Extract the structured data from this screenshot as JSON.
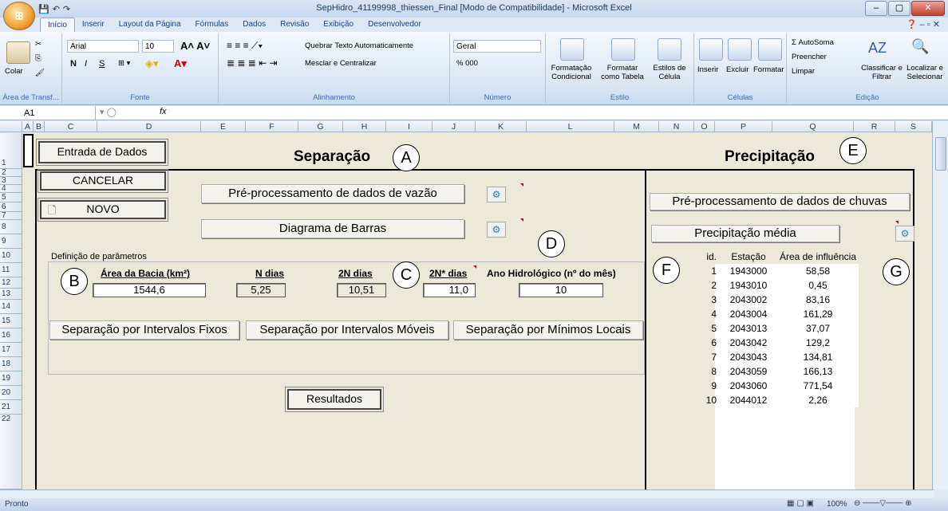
{
  "window": {
    "title": "SepHidro_41199998_thiessen_Final  [Modo de Compatibilidade] - Microsoft Excel",
    "min": "–",
    "max": "▢",
    "close": "✕"
  },
  "ribbon_tabs": [
    "Início",
    "Inserir",
    "Layout da Página",
    "Fórmulas",
    "Dados",
    "Revisão",
    "Exibição",
    "Desenvolvedor"
  ],
  "ribbon": {
    "clipboard": {
      "paste": "Colar",
      "label": "Área de Transf..."
    },
    "font": {
      "name": "Arial",
      "size": "10",
      "label": "Fonte",
      "bold": "N",
      "italic": "I",
      "underline": "S"
    },
    "alignment": {
      "wrap": "Quebrar Texto Automaticamente",
      "merge": "Mesclar e Centralizar",
      "label": "Alinhamento"
    },
    "number": {
      "format": "Geral",
      "percent": "% 000",
      "label": "Número"
    },
    "styles": {
      "cond": "Formatação Condicional",
      "table": "Formatar como Tabela",
      "cell": "Estilos de Célula",
      "label": "Estilo"
    },
    "cells": {
      "insert": "Inserir",
      "delete": "Excluir",
      "format": "Formatar",
      "label": "Células"
    },
    "editing": {
      "autosum": "Σ AutoSoma",
      "fill": "Preencher",
      "clear": "Limpar",
      "sort": "Classificar e Filtrar",
      "find": "Localizar e Selecionar",
      "label": "Edição"
    }
  },
  "formula_bar": {
    "namebox": "A1",
    "fx": "fx",
    "value": ""
  },
  "columns": [
    "A",
    "B",
    "C",
    "D",
    "E",
    "F",
    "G",
    "H",
    "I",
    "J",
    "K",
    "L",
    "M",
    "N",
    "O",
    "P",
    "Q",
    "R",
    "S"
  ],
  "rows": [
    "1",
    "2",
    "3",
    "4",
    "5",
    "6",
    "7",
    "8",
    "9",
    "10",
    "11",
    "12",
    "13",
    "14",
    "15",
    "16",
    "17",
    "18",
    "19",
    "20",
    "21",
    "22"
  ],
  "sheet": {
    "btn_entrada": "Entrada de Dados",
    "btn_cancelar": "CANCELAR",
    "btn_novo": "NOVO",
    "heading_sep": "Separação",
    "heading_prec": "Precipitação",
    "btn_preproc_vazao": "Pré-processamento de dados de vazão",
    "btn_diagrama": "Diagrama de Barras",
    "param_title": "Definição de parâmetros",
    "lbl_area": "Área da Bacia (km²)",
    "lbl_ndias": "N dias",
    "lbl_2ndias": "2N dias",
    "lbl_2nstar": "2N* dias",
    "lbl_ano": "Ano Hidrológico (nº do mês)",
    "val_area": "1544,6",
    "val_ndias": "5,25",
    "val_2ndias": "10,51",
    "val_2nstar": "11,0",
    "val_ano": "10",
    "btn_fixos": "Separação por Intervalos Fixos",
    "btn_moveis": "Separação por Intervalos Móveis",
    "btn_minimos": "Separação por Mínimos Locais",
    "btn_resultados": "Resultados",
    "btn_preproc_chuvas": "Pré-processamento de dados de chuvas",
    "btn_precip_media": "Precipitação média"
  },
  "callouts": {
    "A": "A",
    "B": "B",
    "C": "C",
    "D": "D",
    "E": "E",
    "F": "F",
    "G": "G"
  },
  "stations": {
    "headers": [
      "id.",
      "Estação",
      "Área de influência"
    ],
    "rows": [
      [
        "1",
        "1943000",
        "58,58"
      ],
      [
        "2",
        "1943010",
        "0,45"
      ],
      [
        "3",
        "2043002",
        "83,16"
      ],
      [
        "4",
        "2043004",
        "161,29"
      ],
      [
        "5",
        "2043013",
        "37,07"
      ],
      [
        "6",
        "2043042",
        "129,2"
      ],
      [
        "7",
        "2043043",
        "134,81"
      ],
      [
        "8",
        "2043059",
        "166,13"
      ],
      [
        "9",
        "2043060",
        "771,54"
      ],
      [
        "10",
        "2044012",
        "2,26"
      ]
    ]
  },
  "status": {
    "left": "Pronto",
    "zoom": "100%"
  }
}
